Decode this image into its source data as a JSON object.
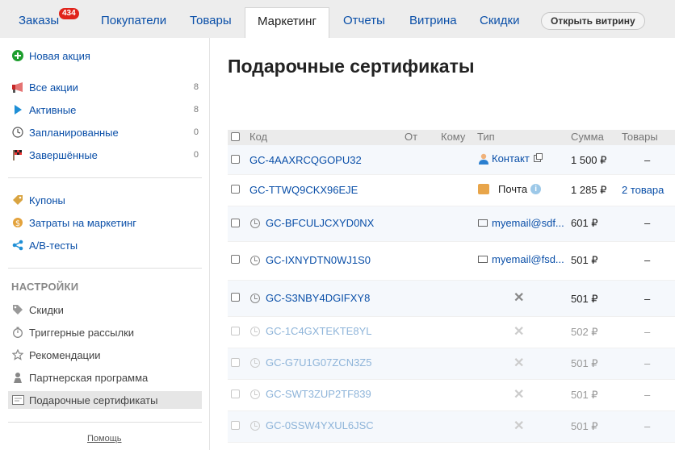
{
  "nav": {
    "tabs": [
      {
        "label": "Заказы",
        "badge": "434"
      },
      {
        "label": "Покупатели"
      },
      {
        "label": "Товары"
      },
      {
        "label": "Маркетинг",
        "active": true
      },
      {
        "label": "Отчеты"
      },
      {
        "label": "Витрина"
      },
      {
        "label": "Скидки"
      }
    ],
    "storefront_button": "Открыть витрину"
  },
  "sidebar": {
    "new_promo": "Новая акция",
    "promos": [
      {
        "label": "Все акции",
        "count": "8",
        "icon": "megaphone-icon"
      },
      {
        "label": "Активные",
        "count": "8",
        "icon": "play-icon"
      },
      {
        "label": "Запланированные",
        "count": "0",
        "icon": "clock-icon"
      },
      {
        "label": "Завершённые",
        "count": "0",
        "icon": "finish-flag-icon"
      }
    ],
    "tools": [
      {
        "label": "Купоны",
        "icon": "coupon-icon"
      },
      {
        "label": "Затраты на маркетинг",
        "icon": "money-icon"
      },
      {
        "label": "A/B-тесты",
        "icon": "share-icon"
      }
    ],
    "settings_heading": "НАСТРОЙКИ",
    "settings": [
      {
        "label": "Скидки",
        "icon": "tag-icon"
      },
      {
        "label": "Триггерные рассылки",
        "icon": "timer-icon"
      },
      {
        "label": "Рекомендации",
        "icon": "star-icon"
      },
      {
        "label": "Партнерская программа",
        "icon": "partner-icon"
      },
      {
        "label": "Подарочные сертификаты",
        "icon": "certificate-icon",
        "selected": true
      }
    ],
    "help": "Помощь"
  },
  "main": {
    "title": "Подарочные сертификаты",
    "columns": {
      "code": "Код",
      "from": "От",
      "to": "Кому",
      "type": "Тип",
      "sum": "Сумма",
      "goods": "Товары"
    },
    "rows": [
      {
        "code": "GC-4AAXRCQGOPU32",
        "clock": false,
        "type": "contact",
        "type_label": "Контакт",
        "sum": "1 500 ₽",
        "goods": "–",
        "dim": false
      },
      {
        "code": "GC-TTWQ9CKX96EJE",
        "clock": false,
        "type": "mail",
        "type_label": "Почта",
        "sum": "1 285 ₽",
        "goods": "2 товара",
        "dim": false
      },
      {
        "code": "GC-BFCULJCXYD0NX",
        "clock": true,
        "type": "email",
        "type_label": "myemail@sdf...",
        "sum": "601 ₽",
        "goods": "–",
        "dim": false
      },
      {
        "code": "GC-IXNYDTN0WJ1S0",
        "clock": true,
        "type": "email",
        "type_label": "myemail@fsd...",
        "sum": "501 ₽",
        "goods": "–",
        "dim": false
      },
      {
        "code": "GC-S3NBY4DGIFXY8",
        "clock": true,
        "type": "none",
        "type_label": "",
        "sum": "501 ₽",
        "goods": "–",
        "dim": false
      },
      {
        "code": "GC-1C4GXTEKTE8YL",
        "clock": true,
        "type": "none",
        "type_label": "",
        "sum": "502 ₽",
        "goods": "–",
        "dim": true
      },
      {
        "code": "GC-G7U1G07ZCN3Z5",
        "clock": true,
        "type": "none",
        "type_label": "",
        "sum": "501 ₽",
        "goods": "–",
        "dim": true
      },
      {
        "code": "GC-SWT3ZUP2TF839",
        "clock": true,
        "type": "none",
        "type_label": "",
        "sum": "501 ₽",
        "goods": "–",
        "dim": true
      },
      {
        "code": "GC-0SSW4YXUL6JSC",
        "clock": true,
        "type": "none",
        "type_label": "",
        "sum": "501 ₽",
        "goods": "–",
        "dim": true
      }
    ]
  },
  "colors": {
    "link": "#0a4fa8",
    "badge": "#e0231b",
    "nav_bg": "#ededed"
  }
}
